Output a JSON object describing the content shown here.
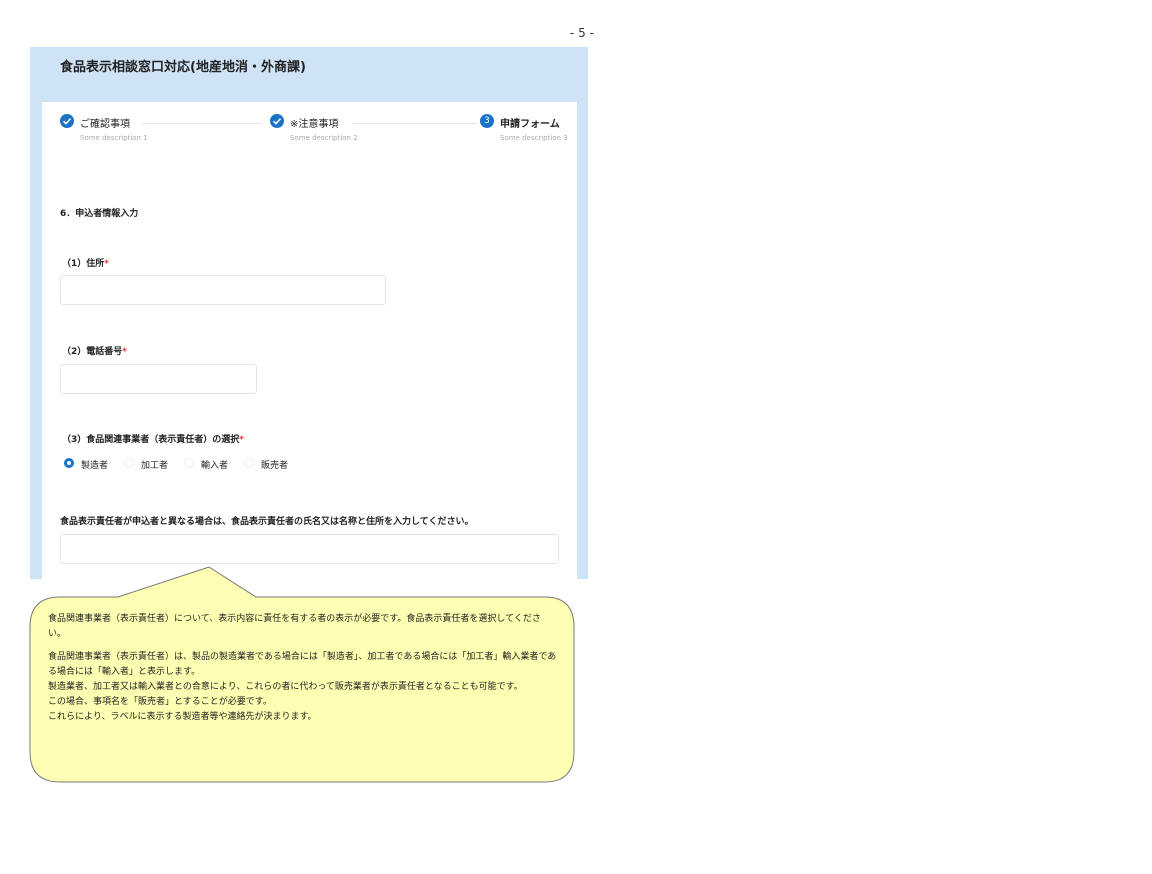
{
  "page_number": "- 5 -",
  "app": {
    "title": "食品表示相談窓口対応(地産地消・外商課)"
  },
  "steps": [
    {
      "icon": "check-icon",
      "label": "ご確認事項",
      "description": "Some description 1"
    },
    {
      "icon": "check-icon",
      "label": "※注意事項",
      "description": "Some description 2"
    },
    {
      "number": "3",
      "label": "申請フォーム",
      "description": "Some description 3"
    }
  ],
  "form": {
    "section_title": "6．申込者情報入力",
    "address_label": "（1）住所",
    "address_value": "",
    "phone_label": "（2）電話番号",
    "phone_value": "",
    "business_type_label": "（3）食品関連事業者（表示責任者）の選択",
    "required_mark": "*",
    "business_types": [
      "製造者",
      "加工者",
      "輸入者",
      "販売者"
    ],
    "selected_business_type": "製造者",
    "responsible_label": "食品表示責任者が申込者と異なる場合は、食品表示責任者の氏名又は名称と住所を入力してください。",
    "responsible_value": ""
  },
  "tooltip": {
    "paragraph1": "食品関連事業者（表示責任者）について、表示内容に責任を有する者の表示が必要です。食品表示責任者を選択してください。",
    "lines": [
      "食品関連事業者（表示責任者）は、製品の製造業者である場合には「製造者」、加工者である場合には「加工者」輸入業者である場合には「輸入者」と表示します。",
      "製造業者、加工者又は輸入業者との合意により、これらの者に代わって販売業者が表示責任者となることも可能です。",
      "この場合、事項名を「販売者」とすることが必要です。",
      "これらにより、ラベルに表示する製造者等や連絡先が決まります。"
    ]
  },
  "colors": {
    "header_band": "#cfe3f6",
    "accent": "#1a73c7",
    "required": "#d9363e",
    "tooltip_fill": "#ffffb3",
    "tooltip_border": "#777777"
  }
}
